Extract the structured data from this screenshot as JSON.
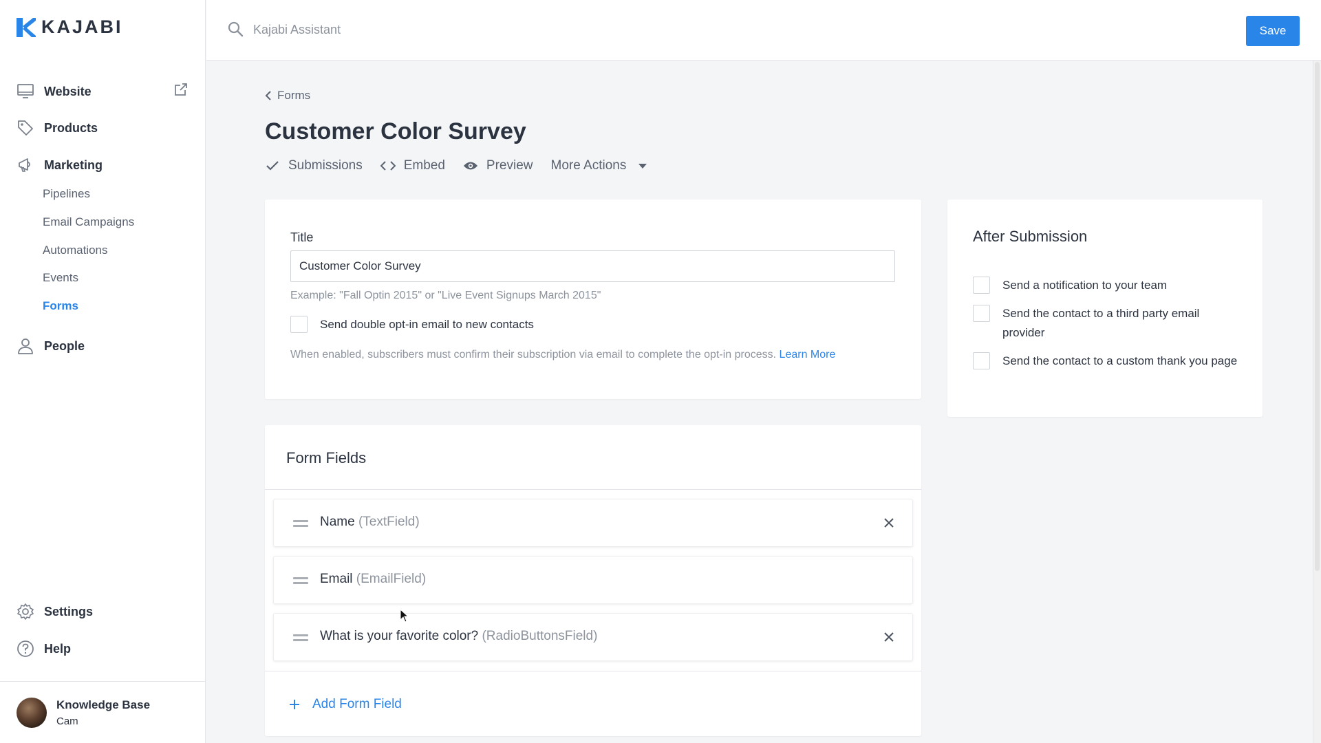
{
  "brand": {
    "name": "KAJABI",
    "accent": "#2a85e8"
  },
  "sidebar": {
    "website": "Website",
    "products": "Products",
    "marketing": "Marketing",
    "marketing_sub": [
      "Pipelines",
      "Email Campaigns",
      "Automations",
      "Events",
      "Forms"
    ],
    "people": "People",
    "settings": "Settings",
    "help": "Help",
    "footer": {
      "name": "Knowledge Base",
      "user": "Cam"
    }
  },
  "topbar": {
    "search_placeholder": "Kajabi Assistant",
    "save_label": "Save"
  },
  "page": {
    "breadcrumb": "Forms",
    "title": "Customer Color Survey",
    "actions": [
      "Submissions",
      "Embed",
      "Preview",
      "More Actions"
    ]
  },
  "settings_card": {
    "title_label": "Title",
    "title_value": "Customer Color Survey",
    "title_hint": "Example: \"Fall Optin 2015\" or \"Live Event Signups March 2015\"",
    "double_optin_label": "Send double opt-in email to new contacts",
    "double_optin_help": "When enabled, subscribers must confirm their subscription via email to complete the opt-in process.",
    "learn_more": "Learn More"
  },
  "form_fields": {
    "title": "Form Fields",
    "fields": [
      {
        "name": "Name",
        "type": "(TextField)",
        "removable": true
      },
      {
        "name": "Email",
        "type": "(EmailField)",
        "removable": false
      },
      {
        "name": "What is your favorite color?",
        "type": "(RadioButtonsField)",
        "removable": true
      }
    ],
    "add_label": "Add Form Field"
  },
  "after_submission": {
    "title": "After Submission",
    "options": [
      "Send a notification to your team",
      "Send the contact to a third party email provider",
      "Send the contact to a custom thank you page"
    ]
  }
}
